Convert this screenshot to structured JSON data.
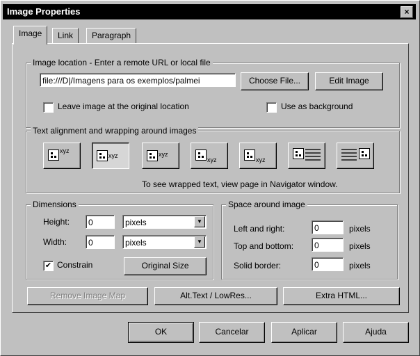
{
  "window": {
    "title": "Image Properties",
    "close_glyph": "×"
  },
  "tabs": [
    {
      "label": "Image",
      "active": true
    },
    {
      "label": "Link",
      "active": false
    },
    {
      "label": "Paragraph",
      "active": false
    }
  ],
  "image_location": {
    "group_label": "Image location - Enter a remote URL or local file",
    "value": "file:///D|/Imagens para os exemplos/palmei",
    "choose_file": "Choose File...",
    "edit_image": "Edit Image",
    "leave_original": "Leave image at the original location",
    "leave_original_checked": false,
    "use_background": "Use as background",
    "use_background_checked": false
  },
  "alignment": {
    "group_label": "Text alignment and wrapping around images",
    "sample_text": "xyz",
    "note": "To see wrapped text, view page in Navigator window."
  },
  "dimensions": {
    "group_label": "Dimensions",
    "height_label": "Height:",
    "height_value": "0",
    "height_unit": "pixels",
    "width_label": "Width:",
    "width_value": "0",
    "width_unit": "pixels",
    "constrain_label": "Constrain",
    "constrain_checked": true,
    "original_size": "Original Size"
  },
  "space": {
    "group_label": "Space around image",
    "left_right_label": "Left and right:",
    "left_right_value": "0",
    "top_bottom_label": "Top and bottom:",
    "top_bottom_value": "0",
    "border_label": "Solid border:",
    "border_value": "0",
    "unit": "pixels"
  },
  "actions": {
    "remove_map": "Remove Image Map",
    "alt_text": "Alt.Text / LowRes...",
    "extra_html": "Extra HTML..."
  },
  "footer": {
    "ok": "OK",
    "cancel": "Cancelar",
    "apply": "Aplicar",
    "help": "Ajuda"
  }
}
